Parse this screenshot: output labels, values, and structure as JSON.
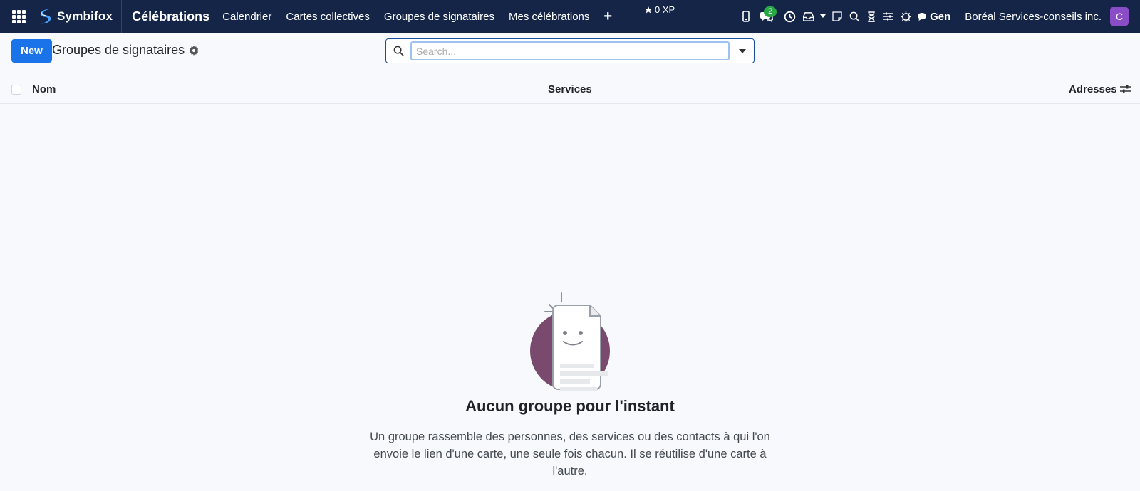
{
  "navbar": {
    "brand": "Symbifox",
    "app_title": "Célébrations",
    "menu": [
      {
        "label": "Calendrier"
      },
      {
        "label": "Cartes collectives"
      },
      {
        "label": "Groupes de signataires"
      },
      {
        "label": "Mes célébrations"
      }
    ],
    "plus": "+",
    "xp": "0 XP",
    "messages_count": "2",
    "gen_label": "Gen",
    "company": "Boréal Services-conseils inc.",
    "avatar_letter": "C",
    "colors": {
      "bar": "#142547",
      "avatar": "#8b4cc8",
      "badge": "#28a745"
    }
  },
  "control_panel": {
    "new_label": "New",
    "title": "Groupes de signataires",
    "search_placeholder": "Search..."
  },
  "table": {
    "columns": [
      "Nom",
      "Services",
      "Adresses"
    ]
  },
  "empty_state": {
    "title": "Aucun groupe pour l'instant",
    "text": "Un groupe rassemble des personnes, des services ou des contacts à qui l'on envoie le lien d'une carte, une seule fois chacun. Il se réutilise d'une carte à l'autre."
  },
  "icons": [
    "apps-grid-icon",
    "symbifox-logo",
    "plus-icon",
    "star-icon",
    "mobile-icon",
    "chat-icon",
    "clock-icon",
    "inbox-icon",
    "note-icon",
    "search-icon",
    "hourglass-icon",
    "sliders-icon",
    "bug-icon",
    "comment-icon",
    "gear-icon",
    "chevron-down-icon",
    "column-settings-icon"
  ]
}
